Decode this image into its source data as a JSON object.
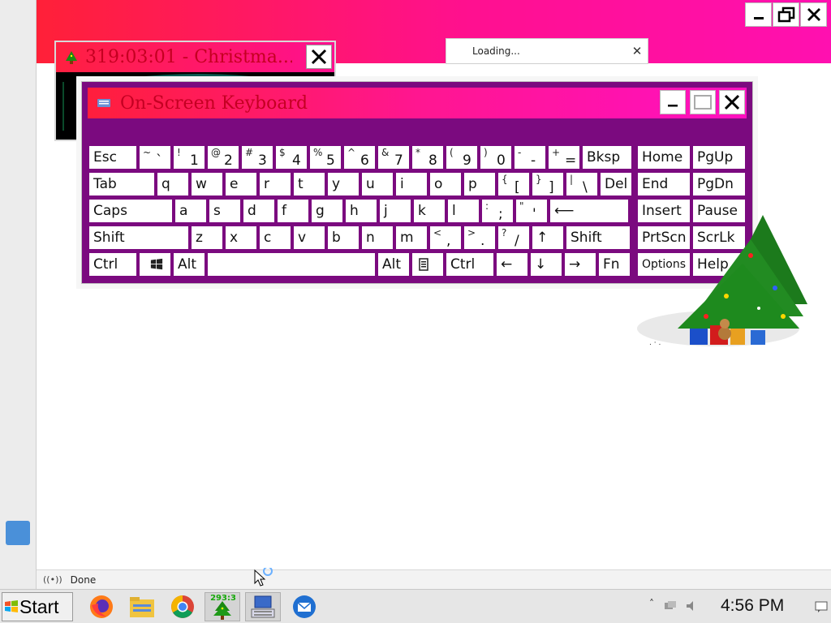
{
  "browser": {
    "status_text": "Done",
    "window_controls": {
      "minimize": "minimize-icon",
      "restore": "restore-icon",
      "close": "close-icon"
    }
  },
  "xmas_window": {
    "title": "319:03:01 - Christma..."
  },
  "loading_dialog": {
    "text": "Loading...",
    "close_label": "✕"
  },
  "osk": {
    "title": "On-Screen Keyboard",
    "colors": {
      "body": "#7b0a7f",
      "title_start": "#ff1e3c",
      "title_end": "#ff10c0"
    },
    "rows": [
      [
        {
          "label": "Esc"
        },
        {
          "alt": "~",
          "main": "`"
        },
        {
          "alt": "!",
          "main": "1"
        },
        {
          "alt": "@",
          "main": "2"
        },
        {
          "alt": "#",
          "main": "3"
        },
        {
          "alt": "$",
          "main": "4"
        },
        {
          "alt": "%",
          "main": "5"
        },
        {
          "alt": "^",
          "main": "6"
        },
        {
          "alt": "&",
          "main": "7"
        },
        {
          "alt": "*",
          "main": "8"
        },
        {
          "alt": "(",
          "main": "9"
        },
        {
          "alt": ")",
          "main": "0"
        },
        {
          "alt": "-",
          "main": "-"
        },
        {
          "alt": "+",
          "main": "="
        },
        {
          "label": "Bksp"
        },
        {
          "label": "Home"
        },
        {
          "label": "PgUp"
        }
      ],
      [
        {
          "label": "Tab"
        },
        {
          "label": "q"
        },
        {
          "label": "w"
        },
        {
          "label": "e"
        },
        {
          "label": "r"
        },
        {
          "label": "t"
        },
        {
          "label": "y"
        },
        {
          "label": "u"
        },
        {
          "label": "i"
        },
        {
          "label": "o"
        },
        {
          "label": "p"
        },
        {
          "alt": "{",
          "main": "["
        },
        {
          "alt": "}",
          "main": "]"
        },
        {
          "alt": "|",
          "main": "\\"
        },
        {
          "label": "Del"
        },
        {
          "label": "End"
        },
        {
          "label": "PgDn"
        }
      ],
      [
        {
          "label": "Caps"
        },
        {
          "label": "a"
        },
        {
          "label": "s"
        },
        {
          "label": "d"
        },
        {
          "label": "f"
        },
        {
          "label": "g"
        },
        {
          "label": "h"
        },
        {
          "label": "j"
        },
        {
          "label": "k"
        },
        {
          "label": "l"
        },
        {
          "alt": ":",
          "main": ";"
        },
        {
          "alt": "\"",
          "main": "'"
        },
        {
          "label": "⟵"
        },
        {
          "label": "Insert"
        },
        {
          "label": "Pause"
        }
      ],
      [
        {
          "label": "Shift"
        },
        {
          "label": "z"
        },
        {
          "label": "x"
        },
        {
          "label": "c"
        },
        {
          "label": "v"
        },
        {
          "label": "b"
        },
        {
          "label": "n"
        },
        {
          "label": "m"
        },
        {
          "alt": "<",
          "main": ","
        },
        {
          "alt": ">",
          "main": "."
        },
        {
          "alt": "?",
          "main": "/"
        },
        {
          "label": "↑"
        },
        {
          "label": "Shift"
        },
        {
          "label": "PrtScn"
        },
        {
          "label": "ScrLk"
        }
      ],
      [
        {
          "label": "Ctrl"
        },
        {
          "icon": "windows-logo-icon",
          "label": ""
        },
        {
          "label": "Alt"
        },
        {
          "label": ""
        },
        {
          "label": "Alt"
        },
        {
          "icon": "menu-key-icon",
          "label": ""
        },
        {
          "label": "Ctrl"
        },
        {
          "label": "←"
        },
        {
          "label": "↓"
        },
        {
          "label": "→"
        },
        {
          "label": "Fn"
        },
        {
          "label": "Options"
        },
        {
          "label": "Help"
        }
      ]
    ]
  },
  "taskbar": {
    "start_label": "Start",
    "tree_badge": "293:3",
    "clock": "4:56 PM",
    "tray_arrow": "˄",
    "items": [
      "firefox-icon",
      "file-manager-icon",
      "chrome-icon",
      "christmas-tree-icon",
      "on-screen-keyboard-icon",
      "thunderbird-icon"
    ]
  }
}
